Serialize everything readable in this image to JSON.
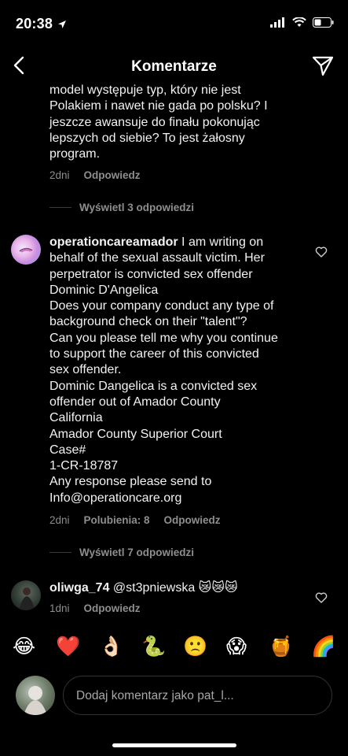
{
  "status_bar": {
    "time": "20:38"
  },
  "header": {
    "title": "Komentarze",
    "back_icon": "chevron-left-icon",
    "send_icon": "paper-plane-icon"
  },
  "comments": [
    {
      "lines": [
        "model występuje typ, który nie jest",
        "Polakiem i nawet nie gada po polsku? I",
        "jeszcze awansuje do finału pokonując",
        "lepszych od siebie? To jest żałosny",
        "program."
      ],
      "time": "2dni",
      "reply_label": "Odpowiedz",
      "view_replies": "Wyświetl 3 odpowiedzi"
    },
    {
      "username": "operationcareamador",
      "first_line_rest": " I am writing on",
      "lines": [
        "behalf of the sexual assault victim. Her",
        "perpetrator is convicted sex offender",
        "Dominic D'Angelica",
        "Does your company conduct any type of",
        "background check on their \"talent\"?",
        "Can you please tell me why you continue",
        "to support the career of this convicted",
        "sex offender.",
        "Dominic Dangelica is a convicted sex",
        "offender out of Amador County",
        "California",
        "Amador County Superior Court",
        "Case#",
        "1-CR-18787",
        "Any response please send to",
        "Info@operationcare.org"
      ],
      "time": "2dni",
      "likes": "Polubienia: 8",
      "reply_label": "Odpowiedz",
      "view_replies": "Wyświetl 7 odpowiedzi"
    },
    {
      "username": "oliwga_74",
      "text": " @st3pniewska 😿😿😿",
      "time": "1dni",
      "reply_label": "Odpowiedz"
    }
  ],
  "emoji_bar": [
    "😂",
    "❤️",
    "👌🏻",
    "🐍",
    "🙁",
    "😱",
    "🍯",
    "🌈"
  ],
  "comment_input": {
    "placeholder": "Dodaj komentarz jako pat_l..."
  }
}
